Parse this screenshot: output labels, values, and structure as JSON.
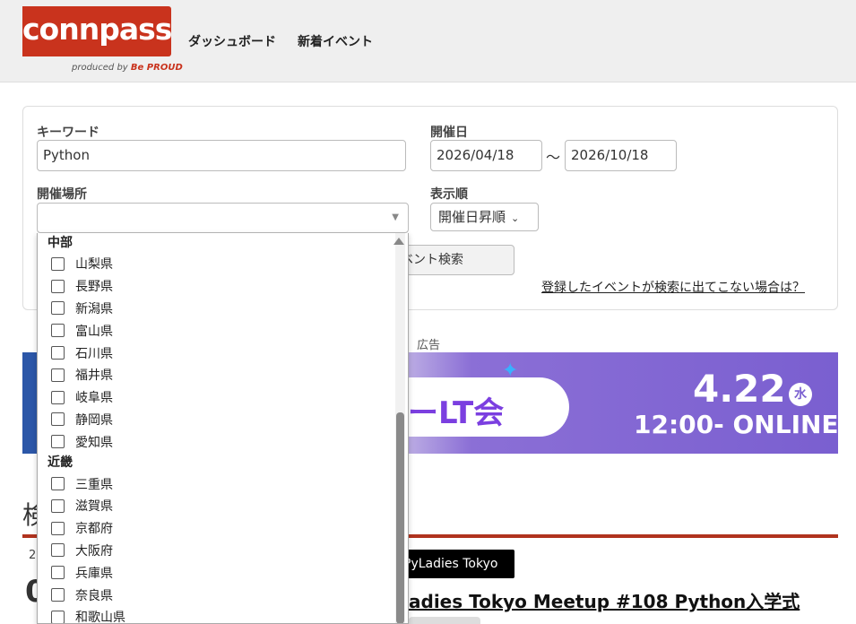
{
  "header": {
    "logo_text": "connpass",
    "logo_sub": "produced by",
    "logo_brand": "Be PROUD",
    "nav": [
      {
        "label": "ダッシュボード"
      },
      {
        "label": "新着イベント"
      }
    ]
  },
  "search": {
    "keyword_label": "キーワード",
    "keyword_value": "Python",
    "date_label": "開催日",
    "date_from": "2026/04/18",
    "date_sep": "〜",
    "date_to": "2026/10/18",
    "location_label": "開催場所",
    "sort_label": "表示順",
    "sort_value": "開催日昇順",
    "search_button": "ベント検索",
    "help_link": "登録したイベントが検索に出てこない場合は？"
  },
  "ad": {
    "label": "広告",
    "banner_lt": "ーLT会",
    "banner_date": "4.22",
    "banner_dow": "水",
    "banner_time": "12:00- ONLINE"
  },
  "results": {
    "heading": "検",
    "small_date": "2",
    "big_initial": "0",
    "group_badge": "PyLadies Tokyo",
    "event_title": "adies Tokyo Meetup #108 Python入学式"
  },
  "dropdown": {
    "groups": [
      {
        "name": "中部",
        "items": [
          "山梨県",
          "長野県",
          "新潟県",
          "富山県",
          "石川県",
          "福井県",
          "岐阜県",
          "静岡県",
          "愛知県"
        ]
      },
      {
        "name": "近畿",
        "items": [
          "三重県",
          "滋賀県",
          "京都府",
          "大阪府",
          "兵庫県",
          "奈良県",
          "和歌山県"
        ]
      }
    ]
  }
}
